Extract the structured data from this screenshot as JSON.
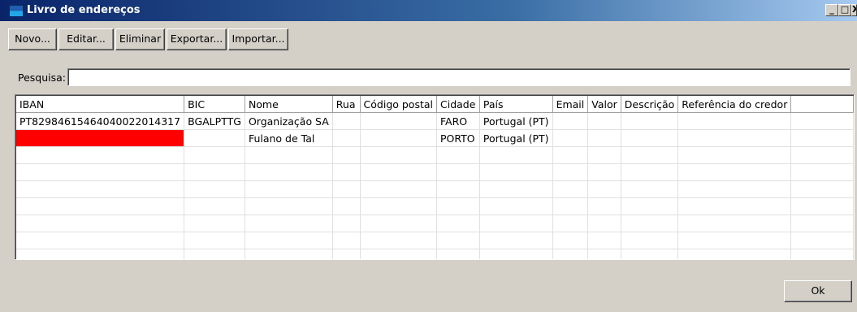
{
  "window": {
    "title": "Livro de endereços"
  },
  "window_controls": {
    "minimize": "_",
    "maximize": "□",
    "close": "X"
  },
  "toolbar": {
    "new_label": "Novo...",
    "edit_label": "Editar...",
    "delete_label": "Eliminar",
    "export_label": "Exportar...",
    "import_label": "Importar..."
  },
  "search": {
    "label": "Pesquisa:",
    "value": ""
  },
  "table": {
    "columns": [
      "IBAN",
      "BIC",
      "Nome",
      "Rua",
      "Código postal",
      "Cidade",
      "País",
      "Email",
      "Valor",
      "Descrição",
      "Referência do credor"
    ],
    "rows": [
      [
        "PT82984615464040022014317",
        "BGALPTTG",
        "Organização SA",
        "",
        "",
        "FARO",
        "Portugal (PT)",
        "",
        "",
        "",
        ""
      ],
      [
        "",
        "",
        "Fulano de Tal",
        "",
        "",
        "PORTO",
        "Portugal (PT)",
        "",
        "",
        "",
        ""
      ]
    ],
    "invalid_cell_color": "#ff0000"
  },
  "footer": {
    "ok_label": "Ok"
  },
  "colors": {
    "titlebar_start": "#0a246a",
    "titlebar_end": "#a6caf0",
    "face": "#d4d0c8"
  }
}
